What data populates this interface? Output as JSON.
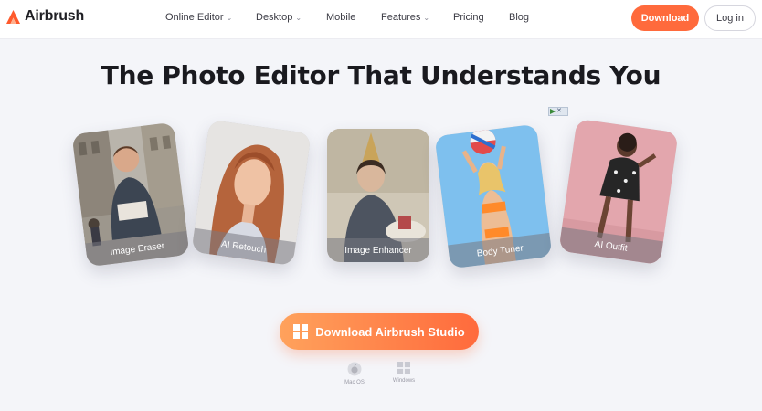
{
  "header": {
    "logo_text": "Airbrush",
    "nav": [
      {
        "label": "Online Editor",
        "has_dropdown": true
      },
      {
        "label": "Desktop",
        "has_dropdown": true
      },
      {
        "label": "Mobile",
        "has_dropdown": false
      },
      {
        "label": "Features",
        "has_dropdown": true
      },
      {
        "label": "Pricing",
        "has_dropdown": false
      },
      {
        "label": "Blog",
        "has_dropdown": false
      }
    ],
    "download_label": "Download",
    "login_label": "Log in"
  },
  "hero": {
    "title": "The Photo Editor That Understands You"
  },
  "cards": [
    {
      "label": "Image Eraser"
    },
    {
      "label": "AI Retouch"
    },
    {
      "label": "Image Enhancer"
    },
    {
      "label": "Body Tuner"
    },
    {
      "label": "AI Outfit"
    }
  ],
  "cta": {
    "label": "Download Airbrush Studio"
  },
  "platforms": [
    {
      "label": "Mac OS",
      "icon": "apple-icon"
    },
    {
      "label": "Windows",
      "icon": "windows-icon"
    }
  ],
  "colors": {
    "accent": "#ff6a3c",
    "accent_light": "#ffa25c",
    "background": "#f4f5f9"
  }
}
